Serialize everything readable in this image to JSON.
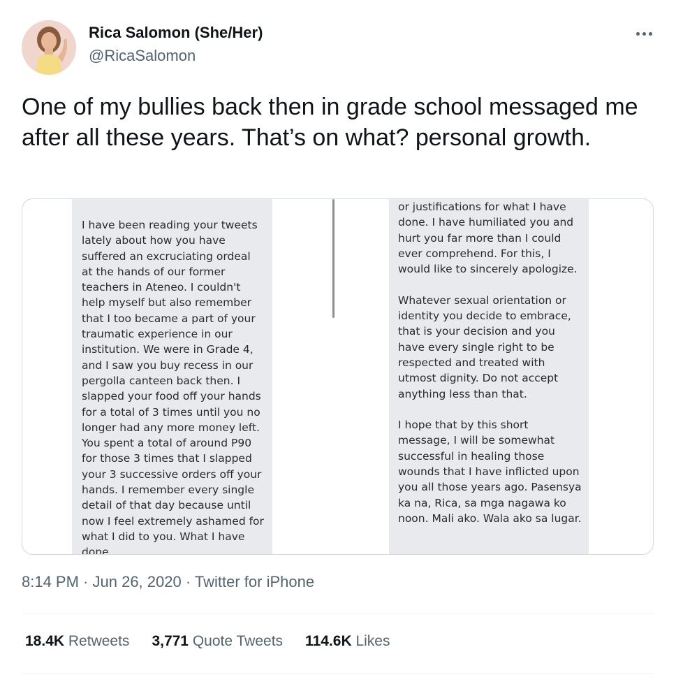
{
  "author": {
    "display_name": "Rica Salomon (She/Her)",
    "handle": "@RicaSalomon"
  },
  "tweet": {
    "text": "One of my bullies back then in grade school messaged me after all these years. That’s on what? personal growth."
  },
  "media": {
    "left_message": "I have been reading your tweets lately about how you have suffered an excruciating ordeal at the hands of our former teachers in Ateneo. I couldn't help myself but also remember that I too became a part of your traumatic experience in our institution. We were in Grade 4, and I saw you buy recess in our pergolla canteen back then. I slapped your food off your hands for a total of 3 times until you no longer had any more money left. You spent a total of around P90 for those 3 times that I slapped your 3 successive orders off your hands. I remember every single detail of that day because until now I feel extremely ashamed for what I did to you. What I have done",
    "right_message": "or justifications for what I have done. I have humiliated you and hurt you far more than I could ever comprehend. For this, I would like to sincerely apologize.\n\nWhatever sexual orientation or identity you decide to embrace, that is your decision and you have every single right to be respected and treated with utmost dignity. Do not accept anything less than that.\n\nI hope that by this short message, I will be somewhat successful in healing those wounds that I have inflicted upon you all those years ago. Pasensya ka na, Rica, sa mga nagawa ko noon. Mali ako. Wala ako sa lugar."
  },
  "meta": {
    "time": "8:14 PM",
    "sep1": " · ",
    "date": "Jun 26, 2020",
    "sep2": " · ",
    "source": "Twitter for iPhone"
  },
  "stats": {
    "retweets_count": "18.4K",
    "retweets_label": "Retweets",
    "quotes_count": "3,771",
    "quotes_label": "Quote Tweets",
    "likes_count": "114.6K",
    "likes_label": "Likes"
  },
  "colors": {
    "text_primary": "#0f1419",
    "text_secondary": "#536471",
    "border": "#cfd9de",
    "bubble_bg": "#e8eaee"
  },
  "icons": {
    "more": "more-horizontal-icon"
  }
}
